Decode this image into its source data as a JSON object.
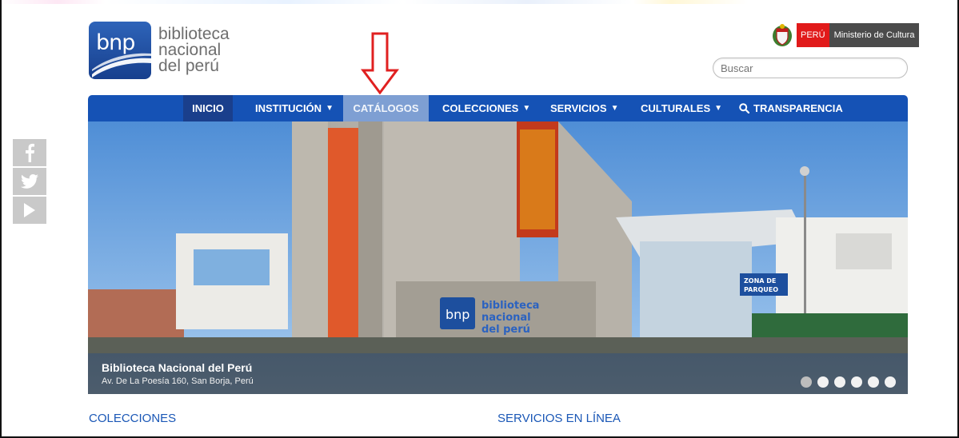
{
  "logo": {
    "mark": "bnp",
    "lines": [
      "biblioteca",
      "nacional",
      "del perú"
    ]
  },
  "gov": {
    "peru": "PERÚ",
    "ministry": "Ministerio de Cultura"
  },
  "search": {
    "placeholder": "Buscar"
  },
  "nav": {
    "items": [
      {
        "label": "INICIO"
      },
      {
        "label": "INSTITUCIÓN"
      },
      {
        "label": "CATÁLOGOS"
      },
      {
        "label": "COLECCIONES"
      },
      {
        "label": "SERVICIOS"
      },
      {
        "label": "CULTURALES"
      },
      {
        "label": "TRANSPARENCIA"
      }
    ],
    "active": "CATÁLOGOS"
  },
  "hero": {
    "title": "Biblioteca Nacional del Perú",
    "subtitle": "Av. De La Poesía 160, San Borja, Perú",
    "slides": 6,
    "current_slide": 1,
    "building_sign": [
      "biblioteca",
      "nacional",
      "del perú"
    ],
    "building_mark": "bnp",
    "parking_sign": [
      "ZONA DE",
      "PARQUEO"
    ]
  },
  "sections": {
    "left": "COLECCIONES",
    "right": "SERVICIOS EN LÍNEA"
  },
  "social": [
    "facebook-icon",
    "twitter-icon",
    "youtube-icon"
  ],
  "colors": {
    "nav_bg": "#1552b5",
    "nav_active_inicio": "#1a3f8c",
    "nav_highlight": "#7e9fd3",
    "link_blue": "#1a57b6",
    "annotation_red": "#e02020"
  }
}
